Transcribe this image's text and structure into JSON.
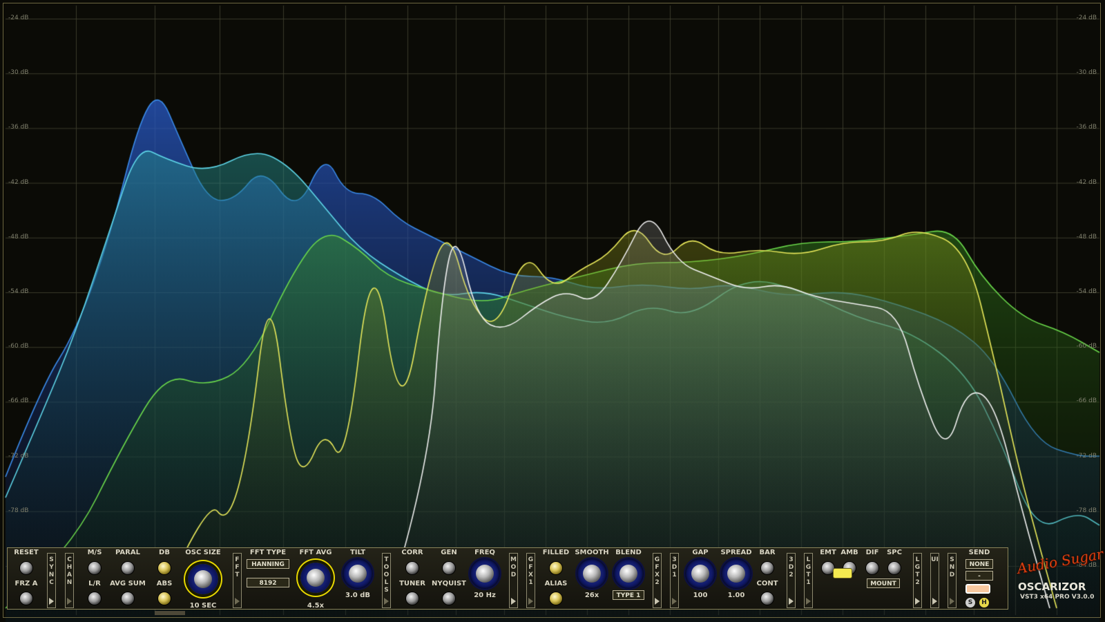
{
  "db_scale": [
    "-24 dB",
    "-30 dB",
    "-36 dB",
    "-42 dB",
    "-48 dB",
    "-54 dB",
    "-60 dB",
    "-66 dB",
    "-72 dB",
    "-78 dB",
    "-84 dB"
  ],
  "colors": {
    "background": "#0b0b06",
    "grid": "#3a3a2a",
    "panel_border": "#8a8358",
    "accent_yellow": "#f4ea50",
    "accent_peach": "#f8c8a0"
  },
  "panel": {
    "reset": "RESET",
    "frz_a": "FRZ A",
    "sync": "SYNC",
    "chan": "CHAN",
    "ms": "M/S",
    "lr": "L/R",
    "paral": "PARAL",
    "avg_sum": "AVG SUM",
    "db": "DB",
    "abs": "ABS",
    "osc_size": "OSC SIZE",
    "osc_size_value": "10 SEC",
    "fft_tab": "FFT",
    "fft_type": "FFT TYPE",
    "fft_type_value": "HANNING",
    "fft_size_value": "8192",
    "fft_avg": "FFT AVG",
    "fft_avg_value": "4.5x",
    "tilt": "TILT",
    "tilt_value": "3.0 dB",
    "tools": "TOOLS",
    "corr": "CORR",
    "tuner": "TUNER",
    "gen": "GEN",
    "nyquist": "NYQUIST",
    "freq": "FREQ",
    "freq_value": "20 Hz",
    "mod": "MOD",
    "gfx1": "GFX1",
    "filled": "FILLED",
    "alias": "ALIAS",
    "smooth": "SMOOTH",
    "smooth_value": "26x",
    "blend": "BLEND",
    "blend_value": "TYPE 1",
    "gfx2": "GFX2",
    "td1": "3D1",
    "gap": "GAP",
    "gap_value": "100",
    "spread": "SPREAD",
    "spread_value": "1.00",
    "bar": "BAR",
    "cont": "CONT",
    "td2": "3D2",
    "lgt1": "LGT1",
    "emt": "EMT",
    "amb": "AMB",
    "dif": "DIF",
    "spc": "SPC",
    "mount": "MOUNT",
    "lgt2": "LGT2",
    "ui": "UI",
    "snd": "SND",
    "send": "SEND",
    "send_value": "NONE",
    "send_value2": "-",
    "s_btn": "S",
    "h_btn": "H"
  },
  "brand": {
    "logo": "Audio Sugar",
    "name": "OSCARIZOR",
    "version": "VST3 x64 PRO V3.0.0"
  }
}
